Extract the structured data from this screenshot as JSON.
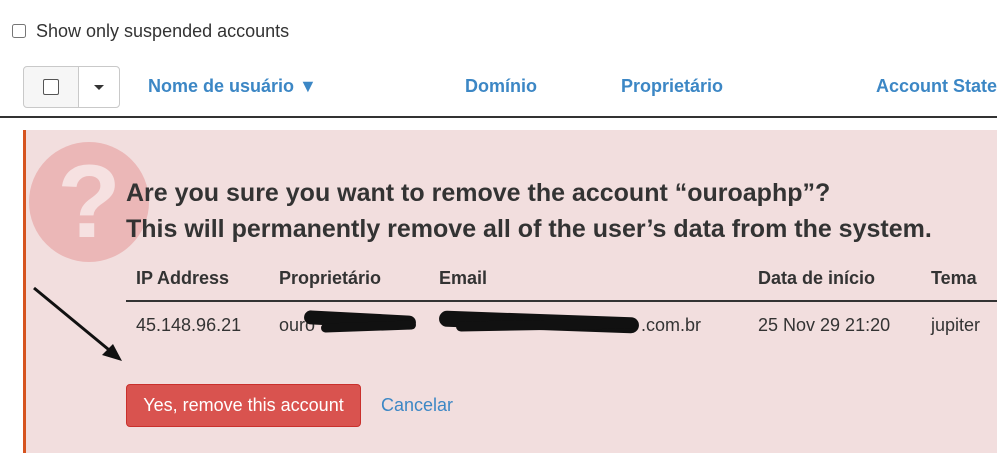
{
  "filters": {
    "show_suspended_label": "Show only suspended accounts"
  },
  "table": {
    "columns": [
      "Nome de usuário ▼",
      "Domínio",
      "Proprietário",
      "Account State"
    ]
  },
  "confirm": {
    "title_line1": "Are you sure you want to remove the account “ouroaphp”?",
    "title_line2": "This will permanently remove all of the user’s data from the system.",
    "columns": [
      "IP Address",
      "Proprietário",
      "Email",
      "Data de início",
      "Tema"
    ],
    "row": {
      "ip": "45.148.96.21",
      "owner": "ouro",
      "email": ".com.br",
      "start_date": "25 Nov 29 21:20",
      "theme": "jupiter"
    },
    "remove_button": "Yes, remove this account",
    "cancel_link": "Cancelar"
  },
  "colors": {
    "link": "#3c87c5",
    "danger": "#d9534f",
    "alert_bg": "#f2dede",
    "alert_border": "#d6531f"
  }
}
